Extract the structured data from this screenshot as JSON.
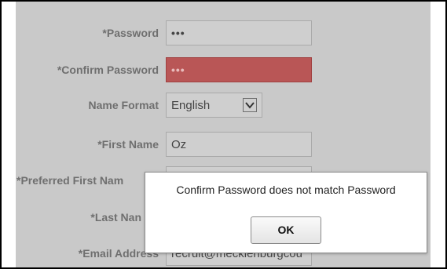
{
  "form": {
    "password": {
      "label": "*Password",
      "value": "•••"
    },
    "confirm_password": {
      "label": "*Confirm Password",
      "value": "•••"
    },
    "name_format": {
      "label": "Name Format",
      "selected": "English"
    },
    "first_name": {
      "label": "*First Name",
      "value": "Oz"
    },
    "preferred_first_name": {
      "label": "*Preferred First Nam"
    },
    "last_name": {
      "label": "*Last Nan"
    },
    "email_address": {
      "label": "*Email Address",
      "value": "recruit@mecklenburgcou"
    }
  },
  "dialog": {
    "message": "Confirm Password does not match Password",
    "ok_label": "OK"
  },
  "colors": {
    "overlay_gray": "#c9c9c9",
    "error_field": "#b95656"
  },
  "icons": {
    "select_arrow": "chevron-down-icon"
  }
}
